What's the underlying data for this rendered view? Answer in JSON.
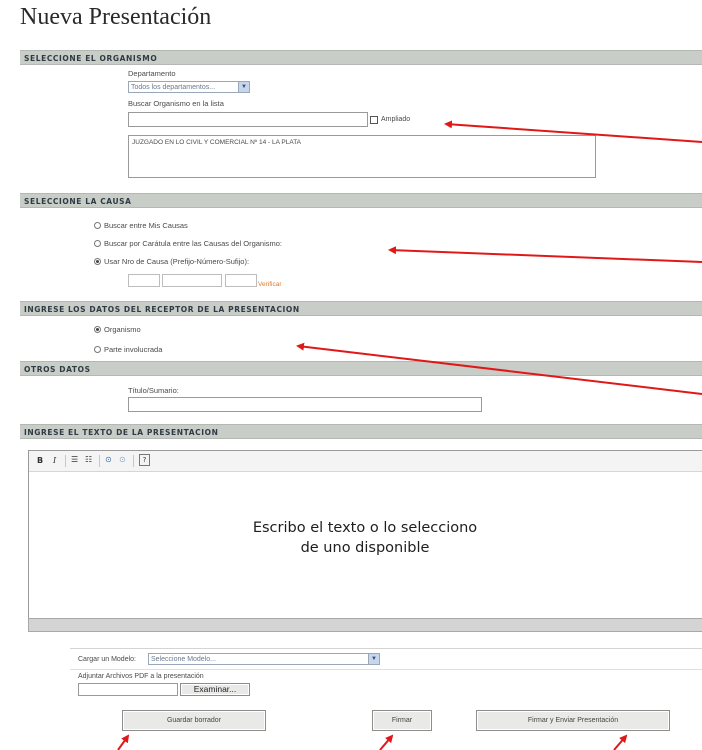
{
  "page_title": "Nueva Presentación",
  "section_organismo": {
    "header": "SELECCIONE EL ORGANISMO",
    "departamento_label": "Departamento",
    "departamento_value": "Todos los departamentos...",
    "buscar_label": "Buscar Organismo en la lista",
    "buscar_value": "",
    "ampliado_label": "Ampliado",
    "list_items": [
      "JUZGADO EN LO CIVIL Y COMERCIAL Nº 14 - LA PLATA"
    ]
  },
  "section_causa": {
    "header": "SELECCIONE LA CAUSA",
    "options": [
      "Buscar entre Mis Causas",
      "Buscar por Carátula entre las Causas del Organismo:",
      "Usar Nro de Causa (Prefijo-Número-Sufijo):"
    ],
    "selected_index": 2,
    "verificar_label": "Verificar"
  },
  "section_receptor": {
    "header": "INGRESE LOS DATOS DEL RECEPTOR DE LA PRESENTACION",
    "options": [
      "Organismo",
      "Parte involucrada"
    ],
    "selected_index": 0
  },
  "section_otros": {
    "header": "OTROS DATOS",
    "titulo_label": "Título/Sumario:",
    "titulo_value": ""
  },
  "section_texto": {
    "header": "INGRESE EL TEXTO DE LA PRESENTACION",
    "toolbar": {
      "bold": "B",
      "italic": "I",
      "help": "?"
    },
    "overlay_line1": "Escribo el texto o lo selecciono",
    "overlay_line2": "de uno disponible"
  },
  "footer": {
    "modelo_label": "Cargar un Modelo:",
    "modelo_value": "Seleccione Modelo...",
    "adjuntar_label": "Adjuntar Archivos PDF a la presentación",
    "examinar_label": "Examinar...",
    "guardar_label": "Guardar borrador",
    "firmar_label": "Firmar",
    "firmar_enviar_label": "Firmar y Enviar Presentación"
  },
  "colors": {
    "section_bar": "#c9cdc8",
    "annotation_arrow": "#e01818",
    "verificar_link": "#e07a2a"
  }
}
